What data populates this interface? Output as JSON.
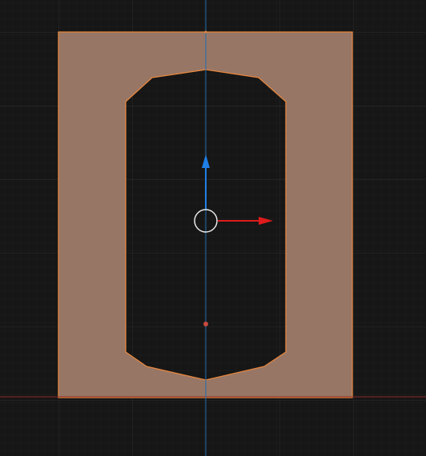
{
  "viewport": {
    "background": "#161616"
  },
  "grid": {
    "minor_color": "#1f1f1f",
    "major_color": "#2c2c2c"
  },
  "axes": {
    "x_axis_color": "#8a2b2b",
    "y_axis_color": "#1f6fb0"
  },
  "selected_mesh": {
    "fill": "#977665",
    "outline": "#e5863e",
    "hole_fill": "#161616",
    "state": "selected"
  },
  "gizmo": {
    "type": "translate",
    "axes": [
      "x",
      "y"
    ],
    "x_color": "#e01b1b",
    "y_color": "#1f7fe6",
    "center_color": "#e8e8e8"
  },
  "pivot_point": {
    "color": "#c84a3f"
  }
}
